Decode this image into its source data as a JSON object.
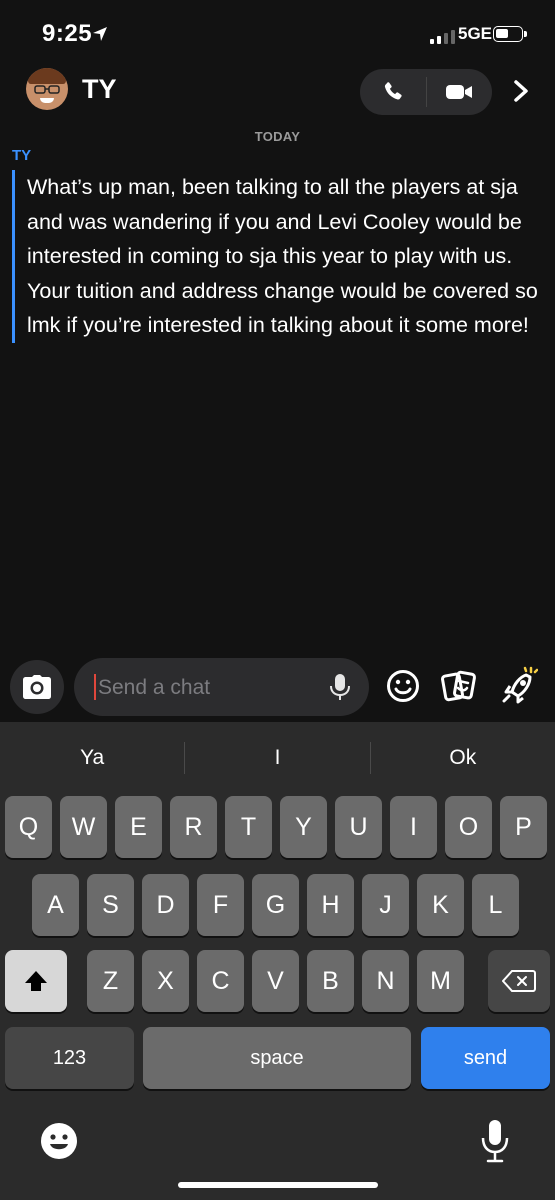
{
  "status_bar": {
    "time": "9:25",
    "network": "5GE"
  },
  "header": {
    "contact_name": "TY",
    "avatar_icon": "bitmoji-avatar",
    "call_icon": "phone-icon",
    "video_icon": "video-camera-icon",
    "more_icon": "chevron-right-icon"
  },
  "chat": {
    "day_label": "TODAY",
    "messages": [
      {
        "sender": "TY",
        "text": "What’s up man, been talking to all the players at sja and was wandering if you and Levi Cooley would be interested in coming to sja this year to play with us. Your tuition and address change would be covered so lmk if you’re interested in talking about it some more!"
      }
    ]
  },
  "composer": {
    "placeholder": "Send a chat",
    "value": "",
    "icons": [
      "camera-icon",
      "microphone-icon",
      "smiley-icon",
      "stickers-icon",
      "rocket-icon"
    ]
  },
  "keyboard": {
    "suggestions": [
      "Ya",
      "I",
      "Ok"
    ],
    "row1": [
      "Q",
      "W",
      "E",
      "R",
      "T",
      "Y",
      "U",
      "I",
      "O",
      "P"
    ],
    "row2": [
      "A",
      "S",
      "D",
      "F",
      "G",
      "H",
      "J",
      "K",
      "L"
    ],
    "row3": [
      "Z",
      "X",
      "C",
      "V",
      "B",
      "N",
      "M"
    ],
    "numbers_label": "123",
    "space_label": "space",
    "send_label": "send"
  },
  "colors": {
    "accent": "#3b91ff",
    "send_key": "#2f80ed",
    "caret": "#e0473c"
  }
}
